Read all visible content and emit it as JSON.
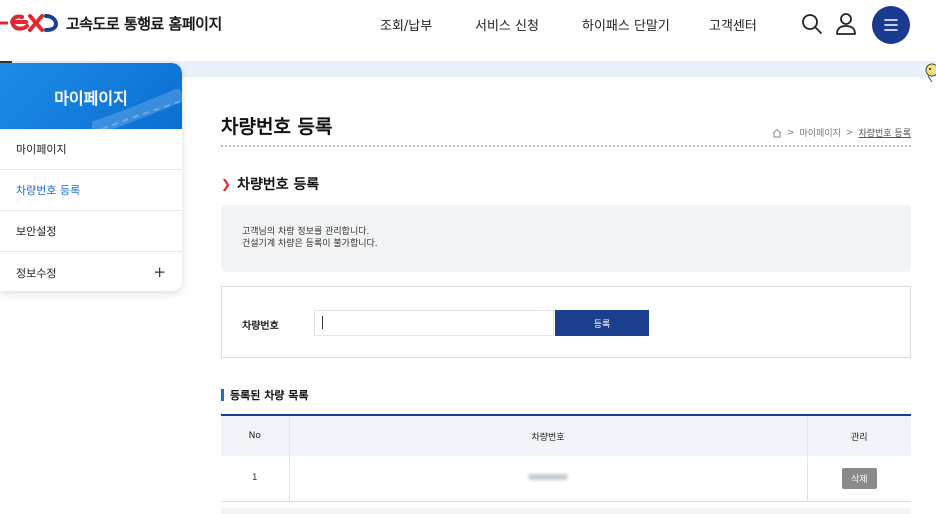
{
  "header": {
    "logo_text": "고속도로 통행료 홈페이지",
    "nav": [
      "조회/납부",
      "서비스 신청",
      "하이패스 단말기",
      "고객센터"
    ],
    "brand_color": "#e3262f",
    "accent_color": "#1b3f8f",
    "icons": [
      "search-icon",
      "user-icon",
      "menu-icon"
    ]
  },
  "sidebar": {
    "title": "마이페이지",
    "items": [
      {
        "label": "마이페이지"
      },
      {
        "label": "차량번호 등록"
      },
      {
        "label": "보안설정"
      },
      {
        "label": "정보수정",
        "expand": "+"
      }
    ],
    "active_index": 1
  },
  "page": {
    "title": "차량번호 등록",
    "breadcrumb": [
      "마이페이지",
      "차량번호 등록"
    ],
    "section_title": "차량번호 등록",
    "info_lines": [
      "고객님의 차량 정보를 관리합니다.",
      "건설기계 차량은 등록이 불가합니다."
    ],
    "form": {
      "label": "차량번호",
      "value": "",
      "button": "등록"
    },
    "list": {
      "title": "등록된 차량 목록",
      "columns": [
        "No",
        "차량번호",
        "관리"
      ],
      "rows": [
        {
          "no": "1",
          "delete": "삭제"
        }
      ]
    }
  }
}
